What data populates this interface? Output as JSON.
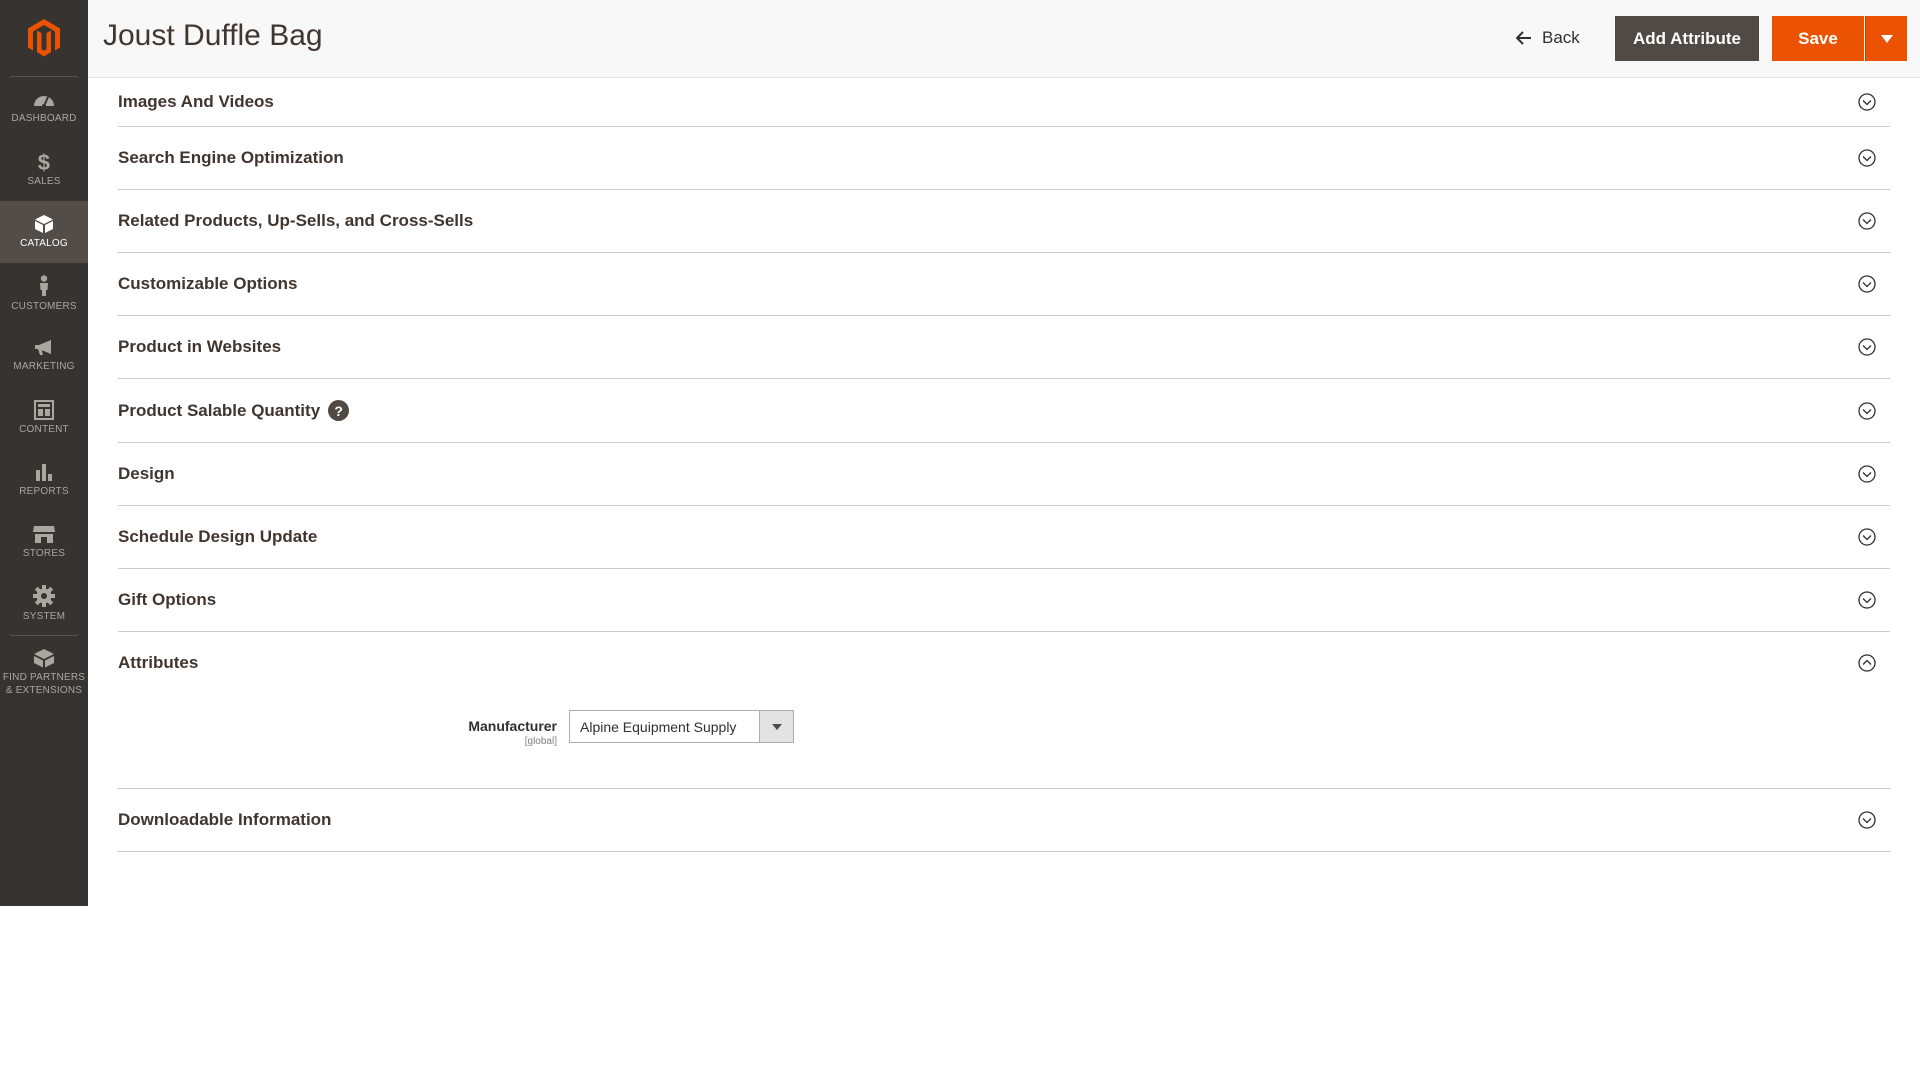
{
  "sidebar": {
    "items": [
      {
        "label": "DASHBOARD",
        "icon": "dashboard-icon"
      },
      {
        "label": "SALES",
        "icon": "dollar-icon"
      },
      {
        "label": "CATALOG",
        "icon": "box-icon",
        "active": true
      },
      {
        "label": "CUSTOMERS",
        "icon": "person-icon"
      },
      {
        "label": "MARKETING",
        "icon": "megaphone-icon"
      },
      {
        "label": "CONTENT",
        "icon": "layout-icon"
      },
      {
        "label": "REPORTS",
        "icon": "bar-chart-icon"
      },
      {
        "label": "STORES",
        "icon": "storefront-icon"
      },
      {
        "label": "SYSTEM",
        "icon": "gear-icon"
      }
    ],
    "partners_line1": "FIND PARTNERS",
    "partners_line2": "& EXTENSIONS"
  },
  "header": {
    "title": "Joust Duffle Bag",
    "back_label": "Back",
    "add_attribute_label": "Add Attribute",
    "save_label": "Save"
  },
  "sections": [
    {
      "title": "Images And Videos"
    },
    {
      "title": "Search Engine Optimization"
    },
    {
      "title": "Related Products, Up-Sells, and Cross-Sells"
    },
    {
      "title": "Customizable Options"
    },
    {
      "title": "Product in Websites"
    },
    {
      "title": "Product Salable Quantity"
    },
    {
      "title": "Design"
    },
    {
      "title": "Schedule Design Update"
    },
    {
      "title": "Gift Options"
    },
    {
      "title": "Attributes"
    },
    {
      "title": "Downloadable Information"
    }
  ],
  "attributes": {
    "manufacturer_label": "Manufacturer",
    "manufacturer_scope": "[global]",
    "manufacturer_value": "Alpine Equipment Supply"
  },
  "colors": {
    "sidebar_bg": "#373330",
    "accent": "#eb5202",
    "secondary_button": "#514943"
  }
}
